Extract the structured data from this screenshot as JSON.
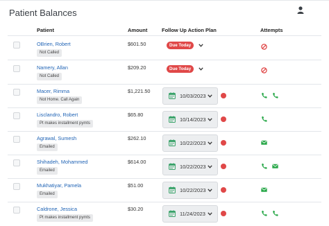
{
  "page": {
    "title": "Patient Balances"
  },
  "columns": {
    "patient": "Patient",
    "amount": "Amount",
    "follow_up": "Follow Up Action Plan",
    "attempts": "Attempts"
  },
  "rows": [
    {
      "name": "OBrien, Robert",
      "tag": "Not Called",
      "amount": "$601.50",
      "plan": "due",
      "due_label": "Due Today",
      "attempts": [
        "no-contact-icon"
      ]
    },
    {
      "name": "Namery, Allan",
      "tag": "Not Called",
      "amount": "$209.20",
      "plan": "due",
      "due_label": "Due Today",
      "attempts": [
        "no-contact-icon"
      ]
    },
    {
      "name": "Macer, Rimma",
      "tag": "Not Home. Call Again",
      "amount": "$1,221.50",
      "plan": "date",
      "date": "10/03/2023",
      "attempts": [
        "phone-icon",
        "phone-icon"
      ]
    },
    {
      "name": "Lisclandro, Robert",
      "tag": "Pt makes installment pymts",
      "amount": "$65.80",
      "plan": "date",
      "date": "10/14/2023",
      "attempts": [
        "phone-icon"
      ]
    },
    {
      "name": "Agrawal, Sumesh",
      "tag": "Emailed",
      "amount": "$262.10",
      "plan": "date",
      "date": "10/22/2023",
      "attempts": [
        "email-icon"
      ]
    },
    {
      "name": "Shihadeh, Mohammed",
      "tag": "Emailed",
      "amount": "$614.00",
      "plan": "date",
      "date": "10/22/2023",
      "attempts": [
        "phone-icon",
        "email-icon"
      ]
    },
    {
      "name": "Mukhatiyar, Pamela",
      "tag": "Emailed",
      "amount": "$51.00",
      "plan": "date",
      "date": "10/22/2023",
      "attempts": [
        "email-icon"
      ]
    },
    {
      "name": "Caldrone, Jessica",
      "tag": "Pt makes installment pymts",
      "amount": "$30.20",
      "plan": "date",
      "date": "11/24/2023",
      "attempts": [
        "phone-icon",
        "phone-icon"
      ]
    }
  ],
  "colors": {
    "link": "#1f63b5",
    "due_badge": "#e04848",
    "status_dot": "#e04848",
    "attempt_icon": "#2aa84a",
    "no_contact_icon": "#e04848",
    "calendar_icon": "#3aa36a"
  }
}
